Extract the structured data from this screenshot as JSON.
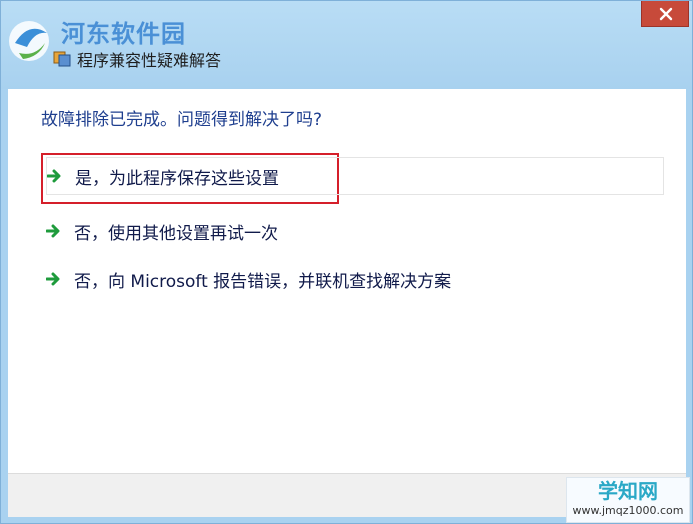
{
  "window": {
    "title": "程序兼容性疑难解答",
    "close_label": "✕"
  },
  "watermarks": {
    "top": "河东软件园",
    "bottom_main": "学知网",
    "bottom_sub": "www.jmqz1000.com"
  },
  "content": {
    "heading": "故障排除已完成。问题得到解决了吗?",
    "options": [
      {
        "label": "是，为此程序保存这些设置",
        "icon": "green-arrow-icon"
      },
      {
        "label": "否，使用其他设置再试一次",
        "icon": "green-arrow-icon"
      },
      {
        "label": "否，向 Microsoft 报告错误，并联机查找解决方案",
        "icon": "green-arrow-icon"
      }
    ]
  },
  "colors": {
    "titlebar": "#a9d2f0",
    "accent_arrow": "#1e9b3c",
    "highlight_box": "#d51f2a",
    "close_button": "#c74a3a"
  }
}
